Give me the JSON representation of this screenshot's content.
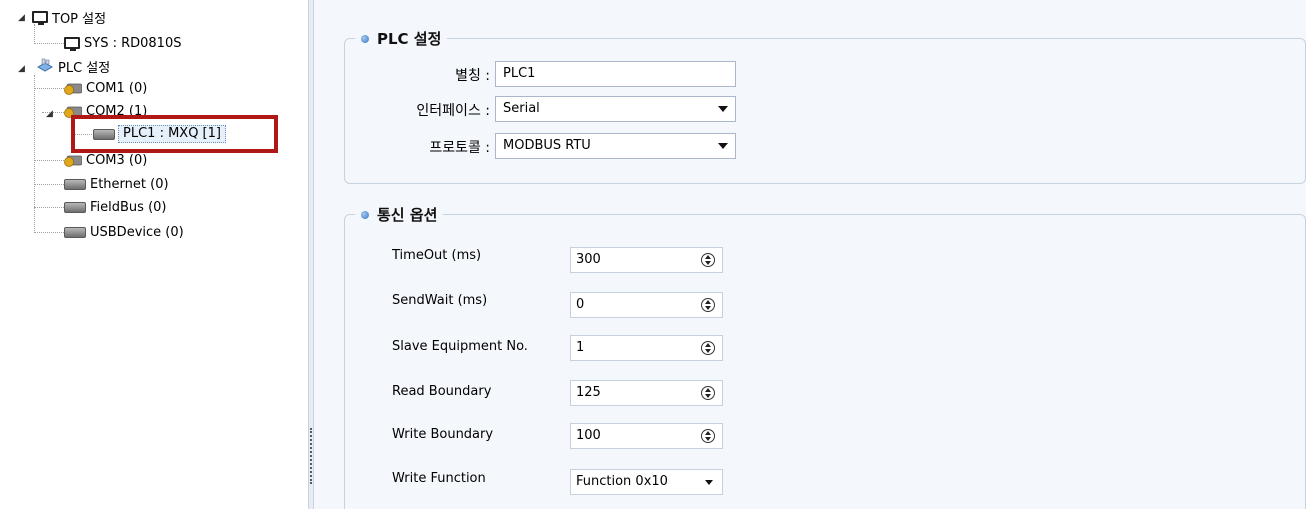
{
  "tree": {
    "root_top": {
      "label": "TOP 설정",
      "icon": "monitor-icon"
    },
    "sys": {
      "label": "SYS : RD0810S",
      "icon": "monitor-icon"
    },
    "root_plc": {
      "label": "PLC 설정",
      "icon": "network-icon"
    },
    "com1": {
      "label": "COM1 (0)",
      "icon": "com-port-icon"
    },
    "com2": {
      "label": "COM2 (1)",
      "icon": "com-port-icon"
    },
    "plc1": {
      "label": "PLC1 : MXQ [1]",
      "icon": "device-icon"
    },
    "com3": {
      "label": "COM3 (0)",
      "icon": "com-port-icon"
    },
    "ethernet": {
      "label": "Ethernet (0)",
      "icon": "device-icon"
    },
    "fieldbus": {
      "label": "FieldBus (0)",
      "icon": "device-icon"
    },
    "usbdevice": {
      "label": "USBDevice (0)",
      "icon": "device-icon"
    }
  },
  "plc_settings": {
    "title": "PLC 설정",
    "alias_label": "별칭 :",
    "alias_value": "PLC1",
    "interface_label": "인터페이스 :",
    "interface_value": "Serial",
    "protocol_label": "프로토콜 :",
    "protocol_value": "MODBUS RTU"
  },
  "comm_options": {
    "title": "통신 옵션",
    "timeout_label": "TimeOut (ms)",
    "timeout_value": "300",
    "sendwait_label": "SendWait (ms)",
    "sendwait_value": "0",
    "slave_label": "Slave Equipment No.",
    "slave_value": "1",
    "read_boundary_label": "Read Boundary",
    "read_boundary_value": "125",
    "write_boundary_label": "Write Boundary",
    "write_boundary_value": "100",
    "write_function_label": "Write Function",
    "write_function_value": "Function 0x10"
  },
  "colors": {
    "highlight_border": "#b01818",
    "panel_background": "#f4f7fc",
    "bullet": "#3a79c0"
  }
}
